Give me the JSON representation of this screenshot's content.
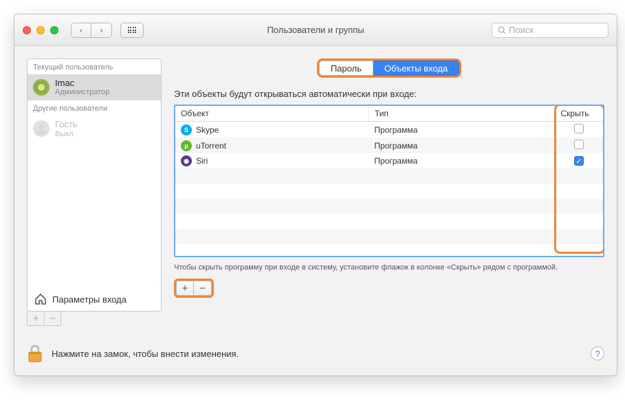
{
  "window_title": "Пользователи и группы",
  "search_placeholder": "Поиск",
  "sidebar": {
    "current_label": "Текущий пользователь",
    "current_user": {
      "name": "Imac",
      "role": "Администратор"
    },
    "others_label": "Другие пользователи",
    "guest": {
      "name": "Гость",
      "status": "Выкл."
    },
    "login_options": "Параметры входа"
  },
  "tabs": {
    "password": "Пароль",
    "login_items": "Объекты входа"
  },
  "heading": "Эти объекты будут открываться автоматически при входе:",
  "columns": {
    "object": "Объект",
    "type": "Тип",
    "hide": "Скрыть"
  },
  "items": [
    {
      "name": "Skype",
      "type": "Программа",
      "hidden": false,
      "icon_bg": "#00aff0",
      "initial": "S"
    },
    {
      "name": "uTorrent",
      "type": "Программа",
      "hidden": false,
      "icon_bg": "#67b82b",
      "initial": "µ"
    },
    {
      "name": "Siri",
      "type": "Программа",
      "hidden": true,
      "icon_bg": "#5a3b8a",
      "initial": "◉"
    }
  ],
  "hint": "Чтобы скрыть программу при входе в систему, установите флажок в колонке «Скрыть» рядом с программой.",
  "lock_text": "Нажмите на замок, чтобы внести изменения."
}
